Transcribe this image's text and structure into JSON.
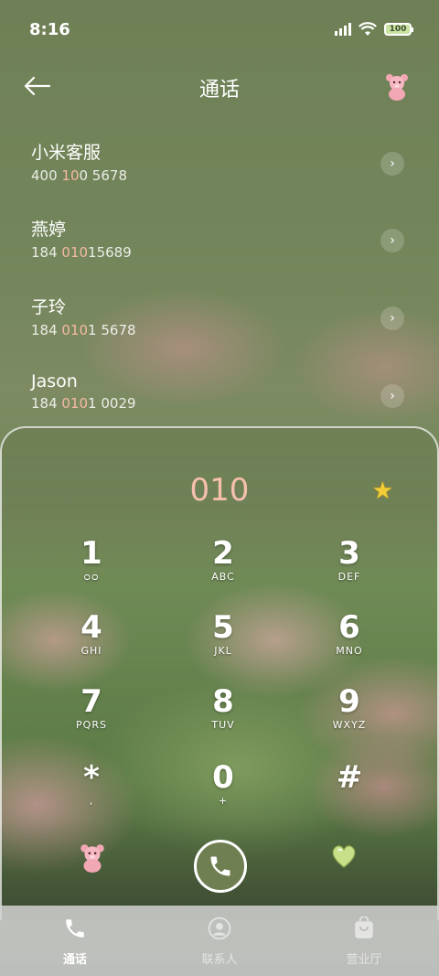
{
  "status": {
    "time": "8:16",
    "battery": "100"
  },
  "header": {
    "title": "通话"
  },
  "contacts": [
    {
      "name": "小米客服",
      "num_pre": "400 ",
      "num_hl": "10",
      "num_post": "0 5678"
    },
    {
      "name": "燕婷",
      "num_pre": "184 ",
      "num_hl": "010",
      "num_post": "15689"
    },
    {
      "name": "子玲",
      "num_pre": "184 ",
      "num_hl": "010",
      "num_post": "1 5678"
    },
    {
      "name": "Jason",
      "num_pre": "184 ",
      "num_hl": "010",
      "num_post": "1 0029"
    }
  ],
  "dialpad": {
    "entry": "010",
    "keys": [
      {
        "digit": "1",
        "letters": "ᴑᴑ"
      },
      {
        "digit": "2",
        "letters": "ABC"
      },
      {
        "digit": "3",
        "letters": "DEF"
      },
      {
        "digit": "4",
        "letters": "GHI"
      },
      {
        "digit": "5",
        "letters": "JKL"
      },
      {
        "digit": "6",
        "letters": "MNO"
      },
      {
        "digit": "7",
        "letters": "PQRS"
      },
      {
        "digit": "8",
        "letters": "TUV"
      },
      {
        "digit": "9",
        "letters": "WXYZ"
      },
      {
        "digit": "*",
        "letters": ","
      },
      {
        "digit": "0",
        "letters": "+"
      },
      {
        "digit": "#",
        "letters": ""
      }
    ]
  },
  "nav": {
    "tab1": "通话",
    "tab2": "联系人",
    "tab3": "营业厅"
  },
  "colors": {
    "accent": "#6f7f52",
    "highlight": "#f4b9a6"
  }
}
